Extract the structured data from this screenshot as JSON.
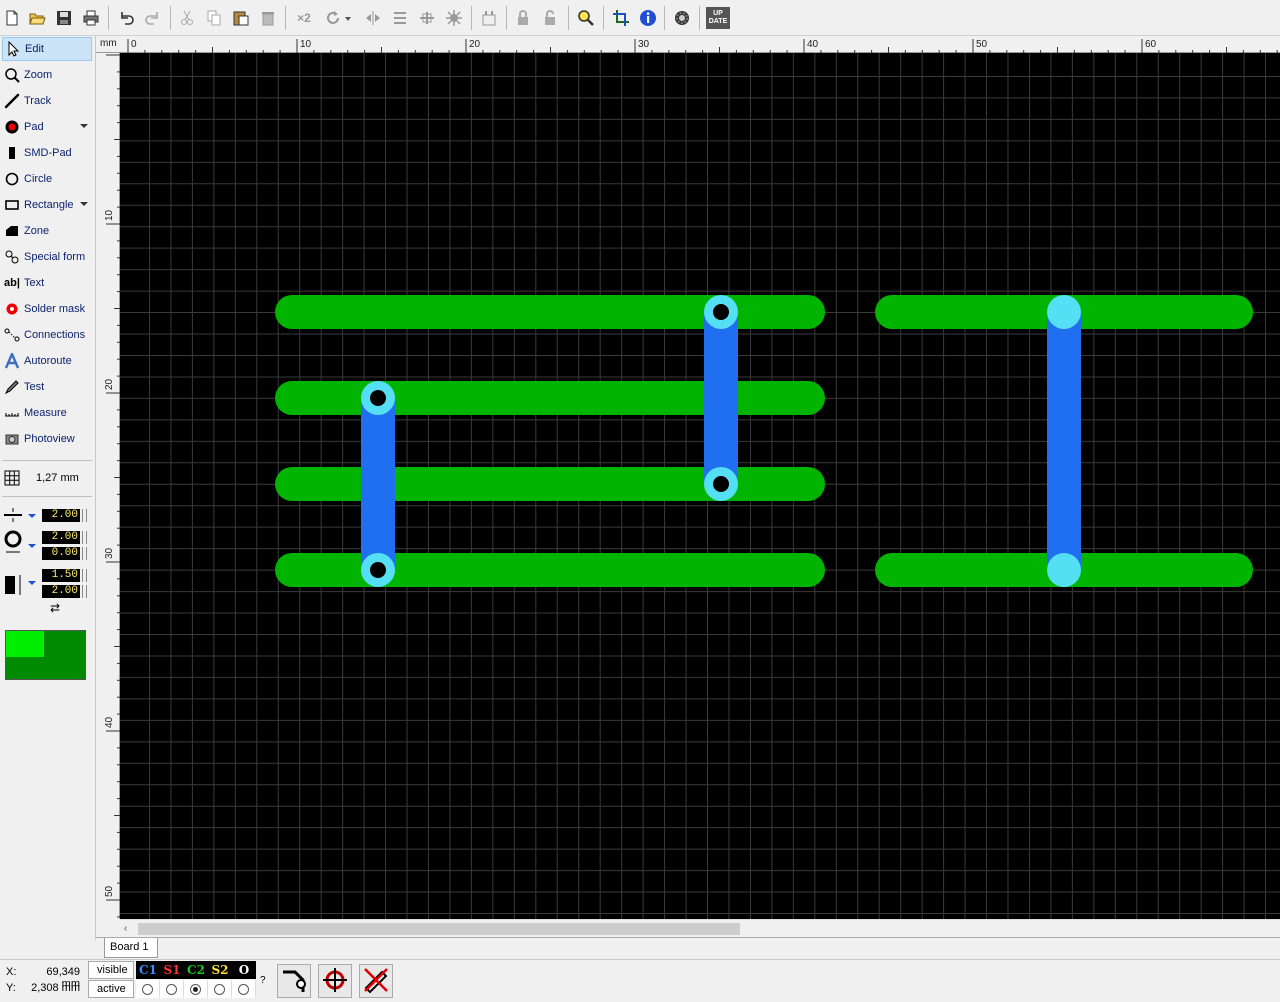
{
  "toolbar": {
    "items": [
      {
        "icon": "new-file-icon"
      },
      {
        "icon": "open-folder-icon"
      },
      {
        "icon": "save-icon"
      },
      {
        "icon": "print-icon"
      },
      {
        "icon": "undo-icon"
      },
      {
        "icon": "redo-icon"
      },
      {
        "icon": "cut-icon"
      },
      {
        "icon": "copy-icon"
      },
      {
        "icon": "paste-icon"
      },
      {
        "icon": "delete-icon"
      },
      {
        "icon": "duplicate-icon"
      },
      {
        "icon": "rotate-icon"
      },
      {
        "icon": "mirror-horizontal-icon"
      },
      {
        "icon": "mirror-vertical-icon"
      },
      {
        "icon": "align-icon"
      },
      {
        "icon": "group-icon"
      },
      {
        "icon": "component-icon"
      },
      {
        "icon": "lock-icon"
      },
      {
        "icon": "unlock-icon"
      },
      {
        "icon": "zoom-icon"
      },
      {
        "icon": "crop-icon"
      },
      {
        "icon": "info-icon"
      },
      {
        "icon": "settings-gear-icon"
      },
      {
        "icon": "update-icon"
      }
    ],
    "x2_label": "×2",
    "update_label_1": "UP",
    "update_label_2": "DATE"
  },
  "tools": [
    {
      "label": "Edit",
      "icon": "edit-cursor-icon",
      "active": true
    },
    {
      "label": "Zoom",
      "icon": "zoom-icon"
    },
    {
      "label": "Track",
      "icon": "track-icon"
    },
    {
      "label": "Pad",
      "icon": "pad-icon",
      "dropdown": true
    },
    {
      "label": "SMD-Pad",
      "icon": "smd-pad-icon"
    },
    {
      "label": "Circle",
      "icon": "circle-icon"
    },
    {
      "label": "Rectangle",
      "icon": "rectangle-icon",
      "dropdown": true
    },
    {
      "label": "Zone",
      "icon": "zone-icon"
    },
    {
      "label": "Special form",
      "icon": "special-form-icon"
    },
    {
      "label": "Text",
      "icon": "text-icon"
    },
    {
      "label": "Solder mask",
      "icon": "solder-mask-icon"
    },
    {
      "label": "Connections",
      "icon": "connections-icon"
    },
    {
      "label": "Autoroute",
      "icon": "autoroute-icon"
    },
    {
      "label": "Test",
      "icon": "test-icon"
    },
    {
      "label": "Measure",
      "icon": "measure-icon"
    },
    {
      "label": "Photoview",
      "icon": "photoview-icon"
    }
  ],
  "grid": {
    "label": "1,27 mm"
  },
  "params": {
    "track_width": "2.00",
    "pad_outer": "2.00",
    "pad_inner": "0.00",
    "smd_width": "1.50",
    "smd_height": "2.00"
  },
  "colors": {
    "canvas": "#000000",
    "grid": "#3a3a3a",
    "copper_top": "#00b400",
    "copper_bottom": "#1f6ff0",
    "pad": "#55dff5",
    "hole": "#000000",
    "preview_light": "#00ee00",
    "preview_dark": "#008a00"
  },
  "ruler": {
    "unit": "mm",
    "x_labels": [
      "0",
      "10",
      "20",
      "30",
      "40",
      "50",
      "60"
    ],
    "y_labels": [
      "10",
      "20",
      "30",
      "40",
      "50"
    ]
  },
  "tabs": [
    {
      "label": "Board 1"
    }
  ],
  "status": {
    "x_label": "X:",
    "x_value": "69,349 mm",
    "y_label": "Y:",
    "y_value": "2,308 mm",
    "visible_label": "visible",
    "active_label": "active",
    "layers": [
      {
        "name": "C1",
        "color": "#3c8cff"
      },
      {
        "name": "S1",
        "color": "#ff3030"
      },
      {
        "name": "C2",
        "color": "#19c819"
      },
      {
        "name": "S2",
        "color": "#ffdc32"
      },
      {
        "name": "O",
        "color": "#ffffff"
      }
    ],
    "active_layer_index": 2,
    "help": "?"
  }
}
